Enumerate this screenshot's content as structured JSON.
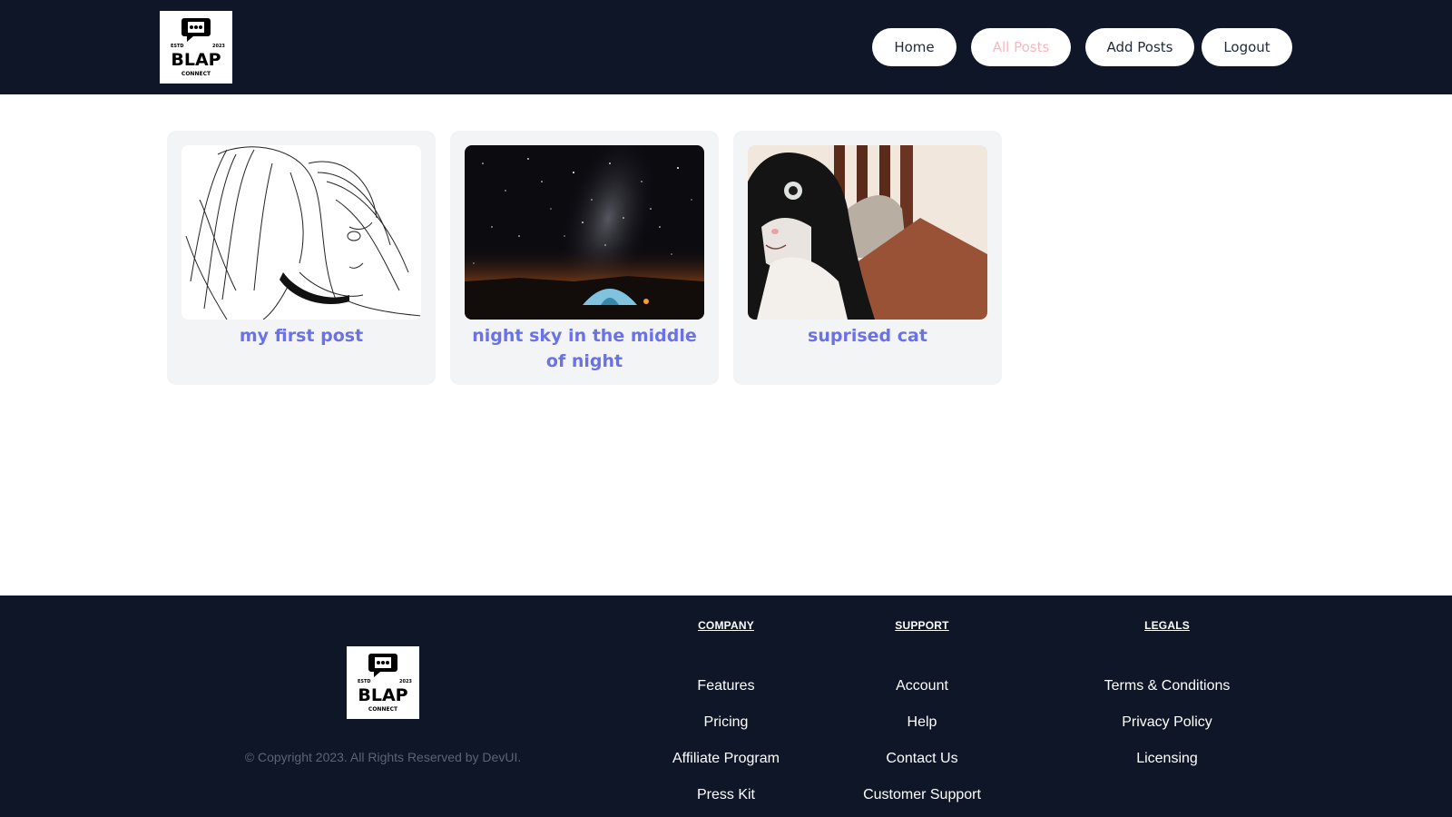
{
  "header": {
    "logo": {
      "top_text": "ESTD",
      "year": "2023",
      "name": "BLAP",
      "sub": "CONNECT"
    },
    "nav": [
      {
        "label": "Home",
        "active": false
      },
      {
        "label": "All Posts",
        "active": true
      },
      {
        "label": "Add Posts",
        "active": false
      },
      {
        "label": "Logout",
        "active": false
      }
    ]
  },
  "posts": [
    {
      "title": "my first post",
      "image": "anime-sketch-girl"
    },
    {
      "title": "night sky in the middle of night",
      "image": "milky-way-tent"
    },
    {
      "title": "suprised cat",
      "image": "black-white-cat"
    }
  ],
  "footer": {
    "logo": {
      "top_text": "ESTD",
      "year": "2023",
      "name": "BLAP",
      "sub": "CONNECT"
    },
    "copyright": "© Copyright 2023. All Rights Reserved by DevUI.",
    "columns": [
      {
        "heading": "COMPANY",
        "links": [
          "Features",
          "Pricing",
          "Affiliate Program",
          "Press Kit"
        ]
      },
      {
        "heading": "SUPPORT",
        "links": [
          "Account",
          "Help",
          "Contact Us",
          "Customer Support"
        ]
      },
      {
        "heading": "LEGALS",
        "links": [
          "Terms & Conditions",
          "Privacy Policy",
          "Licensing"
        ]
      }
    ]
  },
  "colors": {
    "header_bg": "#0e1628",
    "active_nav": "#fbb6c0",
    "post_title": "#6b72e8",
    "card_bg": "#f3f4f6"
  }
}
